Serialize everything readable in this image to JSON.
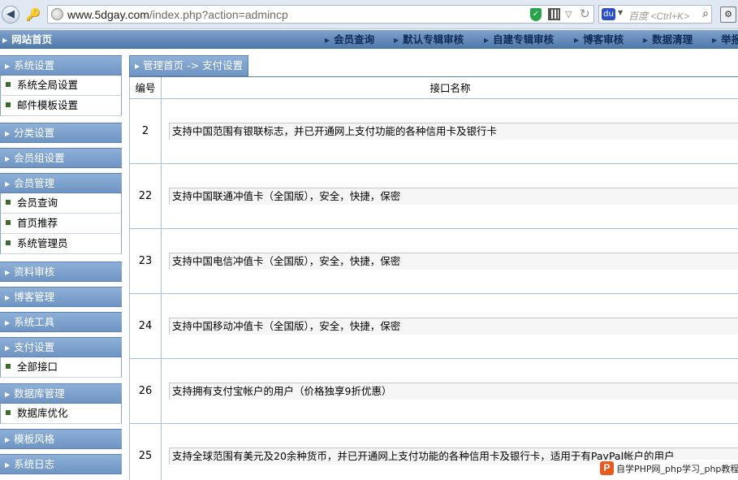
{
  "browser": {
    "url_domain": "www.5dgay.com",
    "url_path": "/index.php?action=admincp",
    "search_placeholder": "百度 <Ctrl+K>"
  },
  "topnav": {
    "home": "网站首页",
    "items": [
      "会员查询",
      "默认专辑审核",
      "自建专辑审核",
      "博客审核",
      "数据清理",
      "举报"
    ]
  },
  "sidebar": {
    "groups": [
      {
        "title": "系统设置",
        "items": [
          "系统全局设置",
          "邮件模板设置"
        ]
      },
      {
        "title": "分类设置",
        "items": []
      },
      {
        "title": "会员组设置",
        "items": []
      },
      {
        "title": "会员管理",
        "items": [
          "会员查询",
          "首页推荐",
          "系统管理员"
        ]
      },
      {
        "title": "资料审核",
        "items": []
      },
      {
        "title": "博客管理",
        "items": []
      },
      {
        "title": "系统工具",
        "items": []
      },
      {
        "title": "支付设置",
        "items": [
          "全部接口"
        ]
      },
      {
        "title": "数据库管理",
        "items": [
          "数据库优化"
        ]
      },
      {
        "title": "模板风格",
        "items": []
      },
      {
        "title": "系统日志",
        "items": []
      }
    ]
  },
  "main": {
    "breadcrumb": "管理首页 -> 支付设置",
    "columns": {
      "id": "编号",
      "name": "接口名称"
    },
    "rows": [
      {
        "id": "2",
        "desc": "支持中国范围有银联标志，并已开通网上支付功能的各种信用卡及银行卡"
      },
      {
        "id": "22",
        "desc": "支持中国联通冲值卡（全国版），安全，快捷，保密"
      },
      {
        "id": "23",
        "desc": "支持中国电信冲值卡（全国版），安全，快捷，保密"
      },
      {
        "id": "24",
        "desc": "支持中国移动冲值卡（全国版），安全，快捷，保密"
      },
      {
        "id": "26",
        "desc": "支持拥有支付宝帐户的用户（价格独享9折优惠）"
      },
      {
        "id": "25",
        "desc": "支持全球范围有美元及20余种货币，并已开通网上支付功能的各种信用卡及银行卡，适用于有PayPal帐户的用户"
      }
    ]
  },
  "watermark": {
    "logo": "P",
    "text": "自学PHP网_php学习_php教程"
  }
}
